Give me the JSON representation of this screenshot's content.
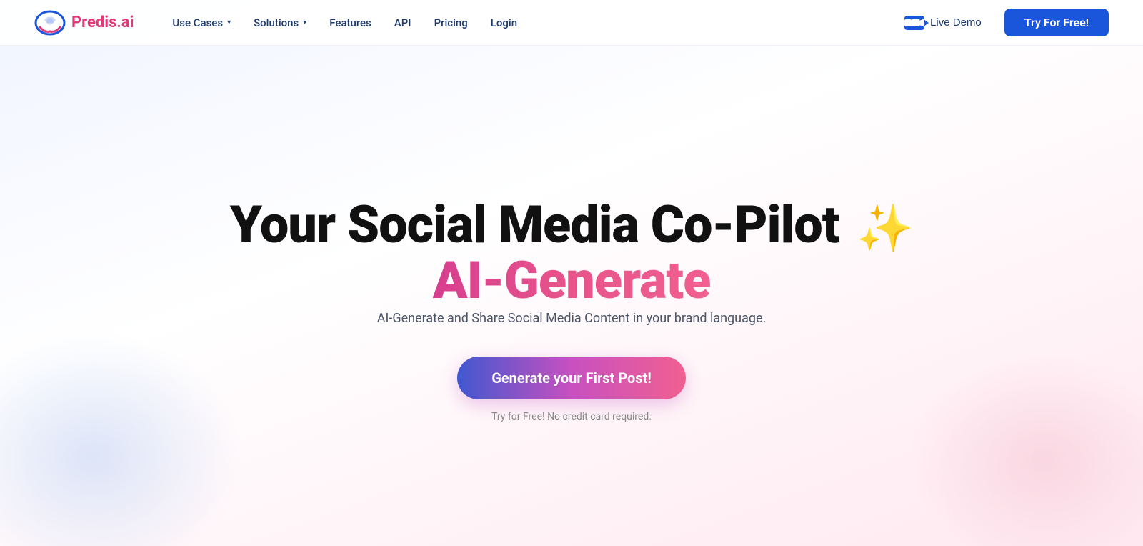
{
  "nav": {
    "logo_text": "Predis",
    "logo_dot": ".ai",
    "links": [
      {
        "label": "Use Cases",
        "has_dropdown": true
      },
      {
        "label": "Solutions",
        "has_dropdown": true
      },
      {
        "label": "Features",
        "has_dropdown": false
      },
      {
        "label": "API",
        "has_dropdown": false
      },
      {
        "label": "Pricing",
        "has_dropdown": false
      },
      {
        "label": "Login",
        "has_dropdown": false
      }
    ],
    "live_demo_label": "Live Demo",
    "try_free_label": "Try For Free!"
  },
  "hero": {
    "title_line1": "Your Social Media Co-Pilot",
    "title_line2": "AI-Generate",
    "sparkle": "✨",
    "subtitle": "AI-Generate and Share Social Media Content in your brand language.",
    "cta_button": "Generate your First Post!",
    "free_note": "Try for Free! No credit card required."
  },
  "colors": {
    "brand_blue": "#1a56db",
    "brand_pink": "#d63f8f",
    "nav_text": "#1e3a6e"
  }
}
